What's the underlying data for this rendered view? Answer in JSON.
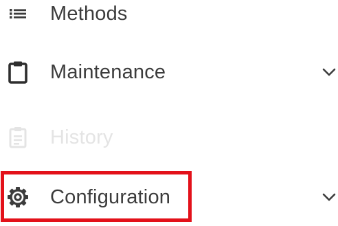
{
  "nav": {
    "items": [
      {
        "label": "Methods",
        "icon": "list-icon",
        "expandable": false,
        "enabled": true
      },
      {
        "label": "Maintenance",
        "icon": "clipboard-icon",
        "expandable": true,
        "enabled": true
      },
      {
        "label": "History",
        "icon": "history-list-icon",
        "expandable": false,
        "enabled": false
      },
      {
        "label": "Configuration",
        "icon": "gear-icon",
        "expandable": true,
        "enabled": true,
        "highlighted": true
      }
    ]
  },
  "colors": {
    "text": "#3c3c3c",
    "disabled_text": "#e4e4e4",
    "icon": "#3c3c3c",
    "disabled_icon": "#e4e4e4",
    "highlight": "#e3111a"
  }
}
